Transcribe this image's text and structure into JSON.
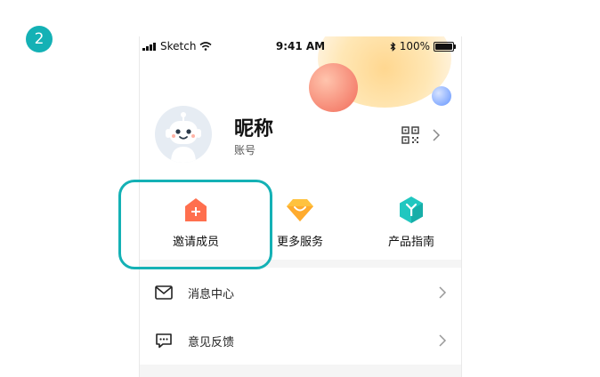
{
  "step": {
    "number": "2"
  },
  "status_bar": {
    "carrier": "Sketch",
    "time": "9:41 AM",
    "battery": "100%"
  },
  "profile": {
    "nickname": "昵称",
    "account_label": "账号"
  },
  "actions": [
    {
      "label": "邀请成员",
      "icon": "invite-member-icon"
    },
    {
      "label": "更多服务",
      "icon": "diamond-icon"
    },
    {
      "label": "产品指南",
      "icon": "guide-cube-icon"
    }
  ],
  "menu": [
    {
      "label": "消息中心",
      "icon": "envelope-icon"
    },
    {
      "label": "意见反馈",
      "icon": "chat-bubble-icon"
    }
  ],
  "colors": {
    "highlight": "#14b1b5",
    "invite": "#ff6f4e",
    "diamond": "#ffc23e",
    "guide": "#21c7c0"
  }
}
